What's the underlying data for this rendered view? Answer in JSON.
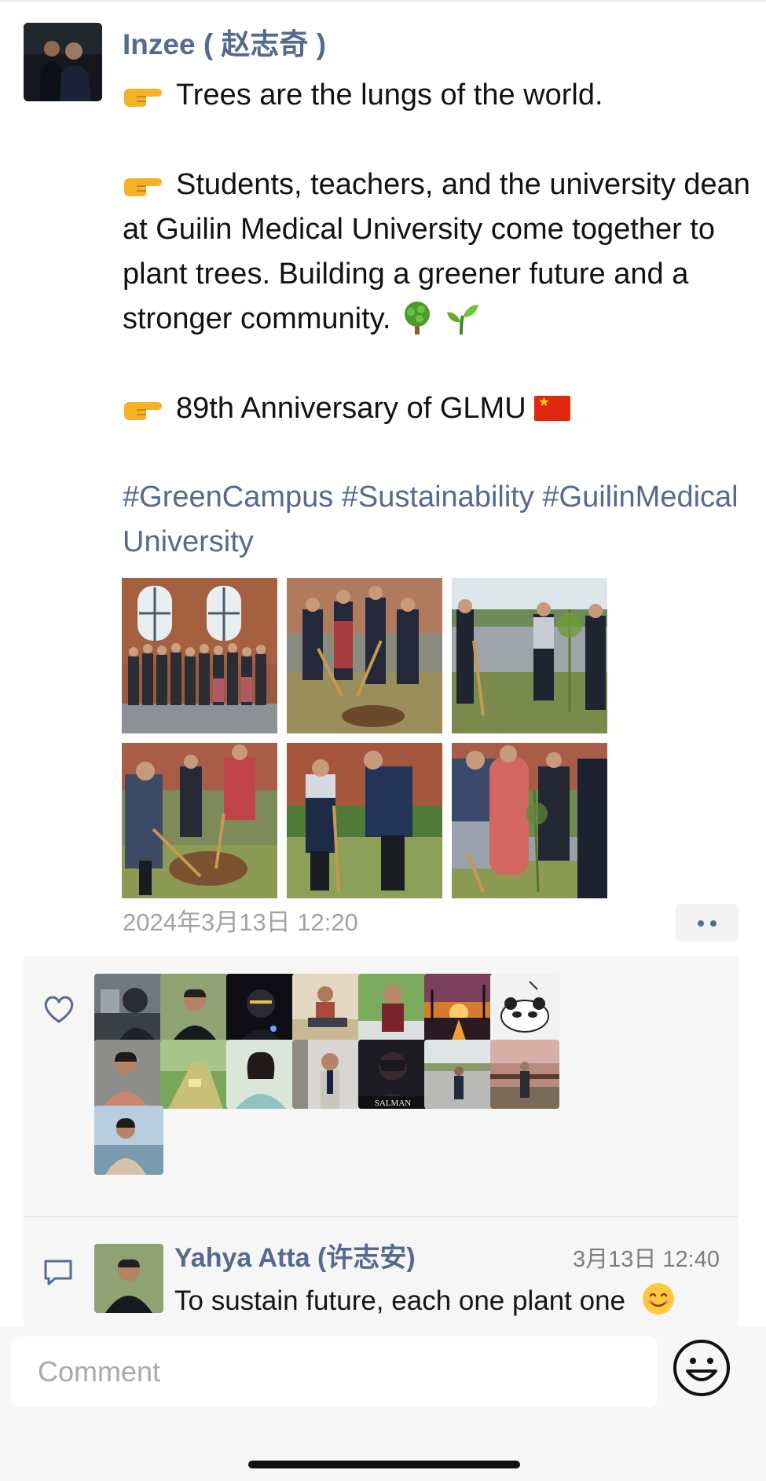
{
  "post": {
    "author_name": "Inzee ( 赵志奇 )",
    "line1": "Trees are the lungs of the world.",
    "line2": "Students, teachers, and the university dean at Guilin Medical University come together to plant trees. Building a greener future and a stronger community.",
    "line3": "89th Anniversary of GLMU",
    "hashtags": "#GreenCampus #Sustainability #GuilinMedicalUniversity",
    "timestamp": "2024年3月13日 12:20",
    "emojis": [
      "backhand-index-pointing-right",
      "deciduous-tree",
      "seedling",
      "china-flag"
    ]
  },
  "photos": [
    {
      "name": "group-photo-in-front-of-building"
    },
    {
      "name": "students-digging-soil"
    },
    {
      "name": "planting-sapling-near-road"
    },
    {
      "name": "digging-with-shovels"
    },
    {
      "name": "two-students-planting"
    },
    {
      "name": "planting-with-red-coat-person"
    }
  ],
  "likes": {
    "icon": "heart-outline-icon",
    "avatars": [
      {
        "name": "liker-1"
      },
      {
        "name": "liker-2"
      },
      {
        "name": "liker-3"
      },
      {
        "name": "liker-4"
      },
      {
        "name": "liker-5"
      },
      {
        "name": "liker-6"
      },
      {
        "name": "liker-7"
      },
      {
        "name": "liker-8"
      },
      {
        "name": "liker-9"
      },
      {
        "name": "liker-10"
      },
      {
        "name": "liker-11"
      },
      {
        "name": "liker-12"
      },
      {
        "name": "liker-13"
      },
      {
        "name": "liker-14"
      },
      {
        "name": "liker-15"
      }
    ],
    "avatar_badge_text": "SALMAN"
  },
  "comments": [
    {
      "author": "Yahya Atta (许志安)",
      "time": "3月13日 12:40",
      "text": "To sustain future, each one plant one"
    }
  ],
  "composer": {
    "placeholder": "Comment",
    "emoji_button_icon": "smiley-face-icon"
  },
  "colors": {
    "link_blue": "#56698e",
    "timestamp_gray": "#a3a3a3",
    "panel_bg": "#f6f6f6",
    "bottom_bar_bg": "#f7f7f7"
  }
}
